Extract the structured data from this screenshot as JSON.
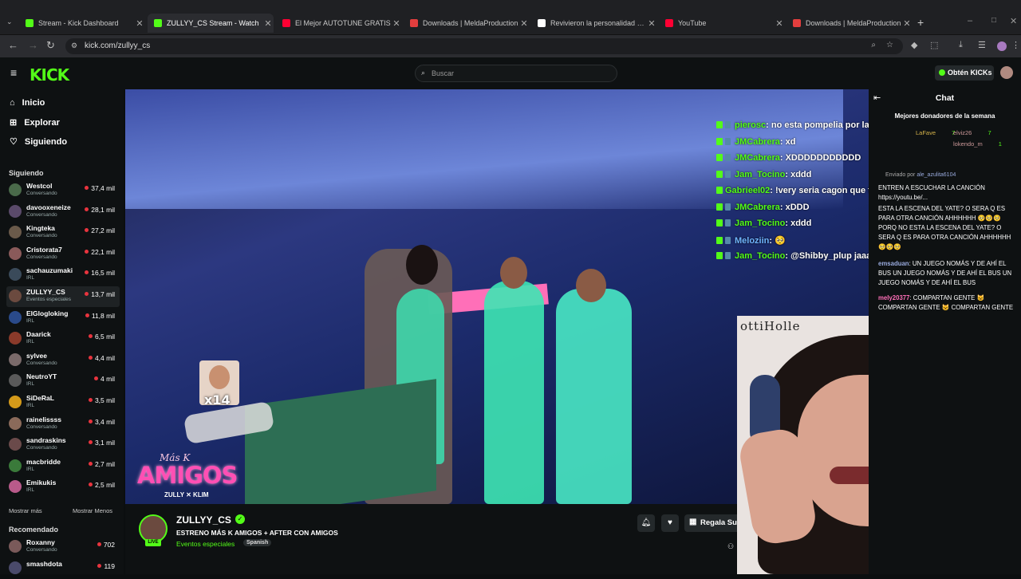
{
  "browser": {
    "tabs": [
      {
        "title": "Stream - Kick Dashboard",
        "fav": "#53fc18"
      },
      {
        "title": "ZULLYY_CS Stream - Watch",
        "fav": "#53fc18",
        "active": true
      },
      {
        "title": "El Mejor AUTOTUNE GRATIS",
        "fav": "#ff0033"
      },
      {
        "title": "Downloads | MeldaProduction",
        "fav": "#e33e3e"
      },
      {
        "title": "Revivieron la personalidad del",
        "fav": "#ffffff"
      },
      {
        "title": "YouTube",
        "fav": "#ff0033"
      },
      {
        "title": "Downloads | MeldaProduction",
        "fav": "#e33e3e"
      }
    ],
    "url": "kick.com/zullyy_cs"
  },
  "header": {
    "logo": "KICK",
    "search_placeholder": "Buscar",
    "kicks_button": "Obtén KICKs"
  },
  "sidebar": {
    "nav": [
      {
        "label": "Inicio",
        "icon": "home-icon"
      },
      {
        "label": "Explorar",
        "icon": "compass-icon"
      },
      {
        "label": "Siguiendo",
        "icon": "heart-icon"
      }
    ],
    "following_heading": "Siguiendo",
    "following": [
      {
        "name": "Westcol",
        "category": "Conversando",
        "viewers": "37,4 mil",
        "color": "#4a6a4a"
      },
      {
        "name": "davooxeneize",
        "category": "Conversando",
        "viewers": "28,1 mil",
        "color": "#5a4a6a"
      },
      {
        "name": "Kingteka",
        "category": "Conversando",
        "viewers": "27,2 mil",
        "color": "#6a5a4a"
      },
      {
        "name": "Cristorata7",
        "category": "Conversando",
        "viewers": "22,1 mil",
        "color": "#8a5a5a"
      },
      {
        "name": "sachauzumaki",
        "category": "IRL",
        "viewers": "16,5 mil",
        "color": "#3a4a5a"
      },
      {
        "name": "ZULLYY_CS",
        "category": "Eventos especiales",
        "viewers": "13,7 mil",
        "color": "#6b4a3f",
        "active": true
      },
      {
        "name": "ElGlogloking",
        "category": "IRL",
        "viewers": "11,8 mil",
        "color": "#2a4a8a"
      },
      {
        "name": "Daarick",
        "category": "IRL",
        "viewers": "6,5 mil",
        "color": "#8a3a2a"
      },
      {
        "name": "sylvee",
        "category": "Conversando",
        "viewers": "4,4 mil",
        "color": "#7a6a6a"
      },
      {
        "name": "NeutroYT",
        "category": "IRL",
        "viewers": "4 mil",
        "color": "#5a5a5a"
      },
      {
        "name": "SiDeRaL",
        "category": "IRL",
        "viewers": "3,5 mil",
        "color": "#d49a1a"
      },
      {
        "name": "rainelissss",
        "category": "Conversando",
        "viewers": "3,4 mil",
        "color": "#8a6a5a"
      },
      {
        "name": "sandraskins",
        "category": "Conversando",
        "viewers": "3,1 mil",
        "color": "#6a4a4a"
      },
      {
        "name": "macbridde",
        "category": "IRL",
        "viewers": "2,7 mil",
        "color": "#3a7a3a"
      },
      {
        "name": "Emikukis",
        "category": "IRL",
        "viewers": "2,5 mil",
        "color": "#b85a8a"
      }
    ],
    "show_more": "Mostrar más",
    "show_less": "Mostrar Menos",
    "recommended_heading": "Recomendado",
    "recommended": [
      {
        "name": "Roxanny",
        "category": "Conversando",
        "viewers": "702",
        "color": "#7a5a5a"
      },
      {
        "name": "smashdota",
        "category": "",
        "viewers": "119",
        "color": "#4a4a6a"
      }
    ]
  },
  "video": {
    "gif_count": "x14",
    "overlay_small": "Más K",
    "overlay_big": "AMIGOS",
    "overlay_sub": "ZULLY ✕ KLIM",
    "chat_overlay": [
      {
        "user": "pierosc",
        "text": ": no esta pompelia por las wbas lloras"
      },
      {
        "user": "JMCabrera",
        "text": ": xd"
      },
      {
        "user": "JMCabrera",
        "text": ": XDDDDDDDDDDD"
      },
      {
        "user": "Jam_Tocino",
        "text": ": xddd"
      },
      {
        "user": "Gabrieel02",
        "text": ": !very seria cagon que te mates y no salgas en noticia.xd"
      },
      {
        "user": "JMCabrera",
        "text": ": xDDD"
      },
      {
        "user": "Jam_Tocino",
        "text": ": xddd"
      },
      {
        "user": "Meloziin",
        "text": ": 🥺"
      },
      {
        "user": "Jam_Tocino",
        "text": ": @Shibby_plup jaaaaasaaa"
      }
    ]
  },
  "stream": {
    "channel": "ZULLYY_CS",
    "live_badge": "LIVE",
    "title": "ESTRENO MÁS K AMIGOS + AFTER CON AMIGOS",
    "category": "Eventos especiales",
    "language": "Spanish",
    "gift_button": "Regala Su"
  },
  "chat": {
    "title": "Chat",
    "donors_heading": "Mejores donadores de la semana",
    "donors": [
      {
        "name": "LaFave",
        "amount": "7"
      },
      {
        "name": "elviz26",
        "amount": "7"
      },
      {
        "name": "lokendo_m",
        "amount": "1"
      }
    ],
    "pinned_from": "Enviado por",
    "pinned_user": "ale_azulita6104",
    "messages": [
      {
        "user": "",
        "text": "ENTREN A ESCUCHAR LA CANCIÓN https://youtu.be/..."
      },
      {
        "user": "",
        "text": "ESTA LA ESCENA DEL YATE? O SERA Q ES PARA OTRA CANCIÓN AHHHHHH 🥺🥺🥺 PORQ NO ESTA LA ESCENA DEL YATE? O SERA Q ES PARA OTRA CANCIÓN AHHHHHH 🥺🥺🥺"
      },
      {
        "user": "emsaduan",
        "text": ": UN JUEGO NOMÁS Y DE AHÍ EL BUS UN JUEGO NOMÁS Y DE AHÍ EL BUS UN JUEGO NOMÁS Y DE AHÍ EL BUS"
      },
      {
        "user": "mely20377",
        "text": ": COMPARTAN GENTE 😺 COMPARTAN GENTE 😺 COMPARTAN GENTE"
      }
    ]
  },
  "cam": {
    "wall_text": "ottiHolle"
  }
}
